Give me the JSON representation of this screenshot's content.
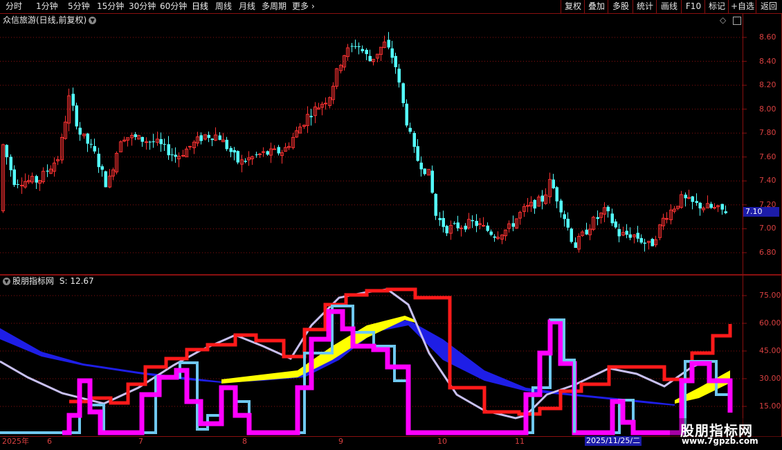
{
  "toolbar": {
    "periods": [
      "分时",
      "1分钟",
      "5分钟",
      "15分钟",
      "30分钟",
      "60分钟",
      "日线",
      "周线",
      "月线",
      "多周期",
      "更多"
    ],
    "active_period": "日线",
    "buttons": [
      "复权",
      "叠加",
      "多股",
      "统计",
      "画线",
      "F10",
      "标记",
      "+自选",
      "返回"
    ]
  },
  "main_panel": {
    "title": "众信旅游(日线,前复权)",
    "current_price": "7.10",
    "price_axis": [
      "8.60",
      "8.40",
      "8.20",
      "8.00",
      "7.80",
      "7.60",
      "7.40",
      "7.20",
      "7.00",
      "6.80"
    ]
  },
  "indicator_panel": {
    "name": "股朋指标网",
    "value_text": "S: 12.67",
    "axis": [
      "75.00",
      "60.00",
      "45.00",
      "30.00",
      "15.00"
    ]
  },
  "date_axis": {
    "labels": [
      "2025年",
      "6",
      "7",
      "8",
      "9",
      "10",
      "11"
    ],
    "cursor_date": "2025/11/25/二"
  },
  "watermark": {
    "title": "股朋指标网",
    "url": "www.7gpzb.com"
  },
  "colors": {
    "up": "#ff3232",
    "down": "#54ffff",
    "grid": "#8a1010",
    "magenta": "#ff00ff",
    "lightblue": "#6fc8f0",
    "lavender": "#c8c0f0",
    "red_line": "#ff1a1a",
    "blue_band": "#1e1ee6",
    "yellow_band": "#ffff00"
  }
}
